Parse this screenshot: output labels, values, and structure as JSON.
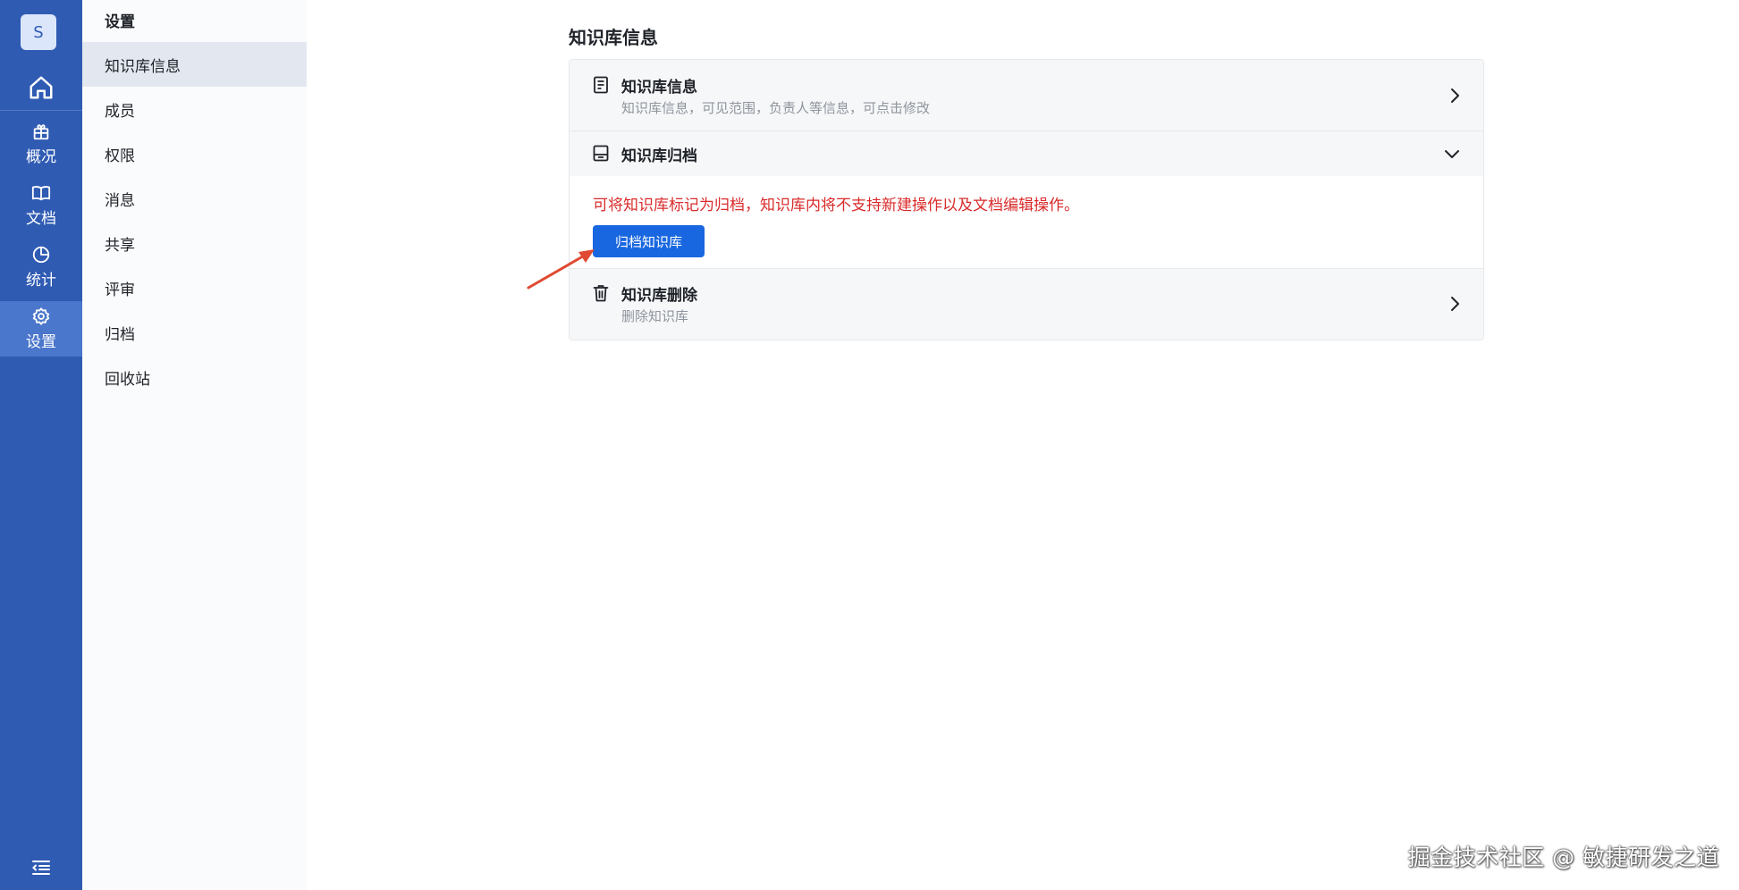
{
  "rail": {
    "avatar_letter": "S",
    "items": [
      {
        "label": "概况",
        "icon": "package-icon"
      },
      {
        "label": "文档",
        "icon": "book-icon"
      },
      {
        "label": "统计",
        "icon": "pie-chart-icon"
      },
      {
        "label": "设置",
        "icon": "gear-icon",
        "active": true
      }
    ]
  },
  "subnav": {
    "title": "设置",
    "items": [
      {
        "label": "知识库信息",
        "active": true
      },
      {
        "label": "成员"
      },
      {
        "label": "权限"
      },
      {
        "label": "消息"
      },
      {
        "label": "共享"
      },
      {
        "label": "评审"
      },
      {
        "label": "归档"
      },
      {
        "label": "回收站"
      }
    ]
  },
  "main": {
    "title": "知识库信息",
    "sections": {
      "info": {
        "title": "知识库信息",
        "description": "知识库信息，可见范围，负责人等信息，可点击修改"
      },
      "archive": {
        "title": "知识库归档",
        "warning": "可将知识库标记为归档，知识库内将不支持新建操作以及文档编辑操作。",
        "button_label": "归档知识库"
      },
      "delete": {
        "title": "知识库删除",
        "description": "删除知识库"
      }
    }
  },
  "colors": {
    "rail_bg": "#2f5bb3",
    "rail_active": "#4a76cb",
    "primary_button": "#1967e0",
    "warning_text": "#d92b2b",
    "annotation_arrow": "#e04a32"
  },
  "watermark": "掘金技术社区 @ 敏捷研发之道"
}
